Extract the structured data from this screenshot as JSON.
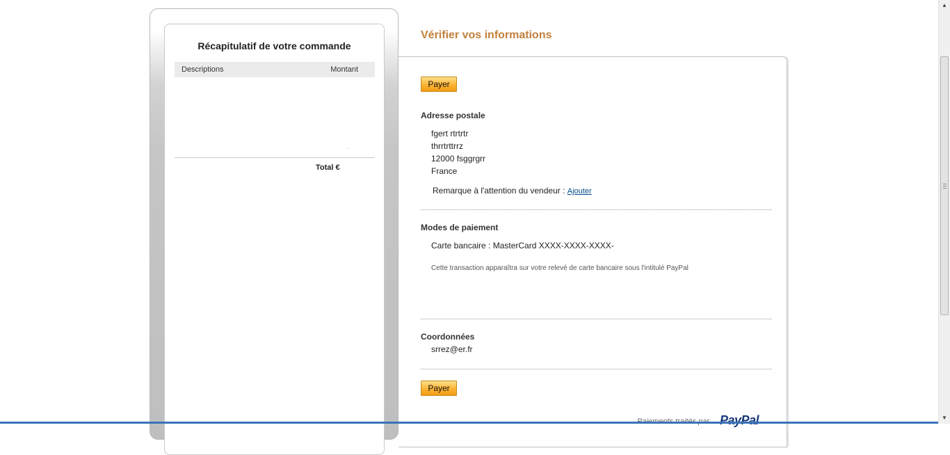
{
  "summary": {
    "title": "Récapitulatif de votre commande",
    "col_descriptions": "Descriptions",
    "col_amount": "Montant",
    "total_label": "Total €"
  },
  "main": {
    "title": "Vérifier vos informations",
    "pay_label": "Payer",
    "address": {
      "title": "Adresse postale",
      "lines": [
        "fgert rtrtrtr",
        "thrrtrttrrz",
        "12000 fsggrgrr",
        "France"
      ],
      "remark_text": "Remarque à l'attention du vendeur :",
      "remark_link": "Ajouter"
    },
    "payment": {
      "title": "Modes de paiement",
      "card_line": "Carte bancaire : MasterCard XXXX-XXXX-XXXX-",
      "note": "Cette transaction apparaîtra sur votre relevé de carte bancaire sous l'intitulé PayPal"
    },
    "contact": {
      "title": "Coordonnées",
      "email": "srrez@er.fr"
    },
    "footer_text": "Paiements traités par",
    "footer_logo": "PayPal"
  },
  "colors": {
    "title_accent": "#c2803c",
    "button": "#fbb434",
    "link": "#064a8c",
    "paypal_brand": "#1a3a7a"
  },
  "icons": {
    "scroll_up": "triangle-up",
    "scroll_down": "triangle-down"
  }
}
